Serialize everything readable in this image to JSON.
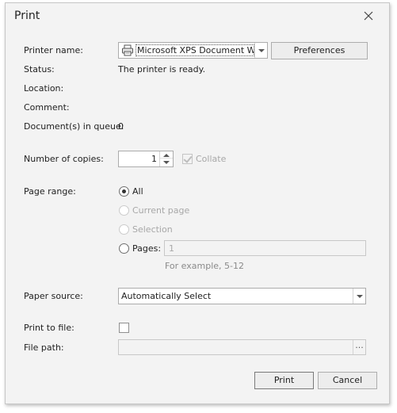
{
  "dialog": {
    "title": "Print"
  },
  "printer": {
    "name_label": "Printer name:",
    "name_value": "Microsoft XPS Document Wr...",
    "preferences_label": "Preferences",
    "status_label": "Status:",
    "status_value": "The printer is ready.",
    "location_label": "Location:",
    "location_value": "",
    "comment_label": "Comment:",
    "comment_value": "",
    "queue_label": "Document(s) in queue:",
    "queue_value": "0"
  },
  "copies": {
    "label": "Number of copies:",
    "value": "1",
    "collate_label": "Collate",
    "collate_checked": true,
    "collate_enabled": false
  },
  "page_range": {
    "label": "Page range:",
    "options": [
      {
        "label": "All",
        "checked": true,
        "enabled": true
      },
      {
        "label": "Current page",
        "checked": false,
        "enabled": false
      },
      {
        "label": "Selection",
        "checked": false,
        "enabled": false
      },
      {
        "label": "Pages:",
        "checked": false,
        "enabled": true
      }
    ],
    "pages_value": "1",
    "example_hint": "For example, 5-12"
  },
  "paper_source": {
    "label": "Paper source:",
    "value": "Automatically Select"
  },
  "output": {
    "print_to_file_label": "Print to file:",
    "print_to_file_checked": false,
    "file_path_label": "File path:",
    "file_path_value": "",
    "browse_label": "..."
  },
  "footer": {
    "print_label": "Print",
    "cancel_label": "Cancel"
  },
  "icons": {
    "close": "close-icon",
    "printer": "printer-icon",
    "dropdown": "chevron-down-icon",
    "spin_up": "spin-up-icon",
    "spin_down": "spin-down-icon"
  }
}
